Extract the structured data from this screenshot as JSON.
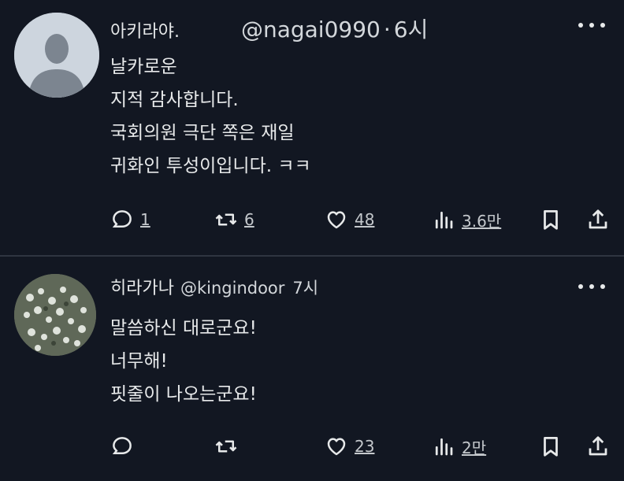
{
  "tweets": [
    {
      "display_name": "아키라야.",
      "handle": "@nagai0990",
      "separator": "·",
      "time": "6시",
      "lines": [
        "날카로운",
        "지적 감사합니다.",
        "국회의원 극단 쪽은 재일",
        "귀화인 투성이입니다. ㅋㅋ"
      ],
      "replies": "1",
      "retweets": "6",
      "likes": "48",
      "views": "3.6만"
    },
    {
      "display_name": "히라가나",
      "handle": "@kingindoor",
      "separator": "",
      "time": "7시",
      "lines": [
        "말씀하신 대로군요!",
        "너무해!",
        "핏줄이 나오는군요!"
      ],
      "replies": "",
      "retweets": "",
      "likes": "23",
      "views": "2만"
    }
  ],
  "icons": {
    "reply": "comment-icon",
    "retweet": "retweet-icon",
    "like": "heart-icon",
    "views": "views-chart-icon",
    "bookmark": "bookmark-icon",
    "share": "share-icon",
    "more": "more-dots-icon"
  },
  "colors": {
    "background": "#121722",
    "text": "#e7e9ea",
    "secondary": "#c4c8cc",
    "divider": "#2f3541"
  }
}
